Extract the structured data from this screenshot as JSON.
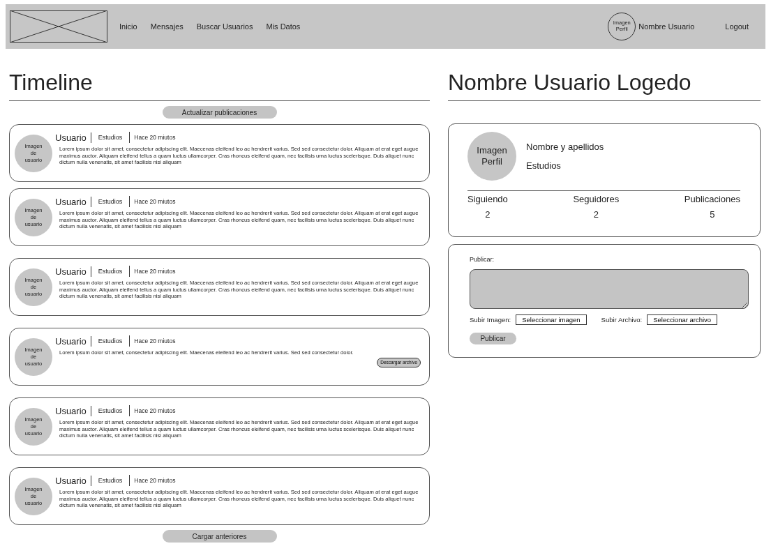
{
  "navbar": {
    "links": [
      {
        "label": "Inicio"
      },
      {
        "label": "Mensajes"
      },
      {
        "label": "Buscar Usuarios"
      },
      {
        "label": "Mis Datos"
      }
    ],
    "avatar": "Imagen\nPerfil",
    "user": "Nombre Usuario",
    "logout": "Logout"
  },
  "timeline": {
    "title": "Timeline",
    "refresh": "Actualizar publicaciones",
    "load_more": "Cargar anteriores",
    "posts": [
      {
        "avatar": "Imagen\nde\nusuario",
        "user": "Usuario",
        "studies": "Estudios",
        "time": "Hace 20 miutos",
        "body": "Lorem ipsum dolor sit amet, consectetur adipiscing elit. Maecenas eleifend leo ac hendrerit varius. Sed sed consectetur dolor. Aliquam at erat eget augue maximus auctor. Aliquam eleifend tellus a quam luctus ullamcorper. Cras rhoncus eleifend quam, nec facilisis urna luctus scelerisque. Duis aliquet nunc dictum nulla venenatis, sit amet facilisis nisi aliquam"
      },
      {
        "avatar": "Imagen\nde\nusuario",
        "user": "Usuario",
        "studies": "Estudios",
        "time": "Hace 20 miutos",
        "body": "Lorem ipsum dolor sit amet, consectetur adipiscing elit. Maecenas eleifend leo ac hendrerit varius. Sed sed consectetur dolor. Aliquam at erat eget augue maximus auctor. Aliquam eleifend tellus a quam luctus ullamcorper. Cras rhoncus eleifend quam, nec facilisis urna luctus scelerisque. Duis aliquet nunc dictum nulla venenatis, sit amet facilisis nisi aliquam"
      },
      {
        "avatar": "Imagen\nde\nusuario",
        "user": "Usuario",
        "studies": "Estudios",
        "time": "Hace 20 miutos",
        "body": "Lorem ipsum dolor sit amet, consectetur adipiscing elit. Maecenas eleifend leo ac hendrerit varius. Sed sed consectetur dolor. Aliquam at erat eget augue maximus auctor. Aliquam eleifend tellus a quam luctus ullamcorper. Cras rhoncus eleifend quam, nec facilisis urna luctus scelerisque. Duis aliquet nunc dictum nulla venenatis, sit amet facilisis nisi aliquam"
      },
      {
        "avatar": "Imagen\nde\nusuario",
        "user": "Usuario",
        "studies": "Estudios",
        "time": "Hace 20 miutos",
        "body": "Lorem ipsum dolor sit amet, consectetur adipiscing elit. Maecenas eleifend leo ac hendrerit varius. Sed sed consectetur dolor.",
        "attachment": "Descargar archivo"
      },
      {
        "avatar": "Imagen\nde\nusuario",
        "user": "Usuario",
        "studies": "Estudios",
        "time": "Hace 20 miutos",
        "body": "Lorem ipsum dolor sit amet, consectetur adipiscing elit. Maecenas eleifend leo ac hendrerit varius. Sed sed consectetur dolor. Aliquam at erat eget augue maximus auctor. Aliquam eleifend tellus a quam luctus ullamcorper. Cras rhoncus eleifend quam, nec facilisis urna luctus scelerisque. Duis aliquet nunc dictum nulla venenatis, sit amet facilisis nisi aliquam"
      },
      {
        "avatar": "Imagen\nde\nusuario",
        "user": "Usuario",
        "studies": "Estudios",
        "time": "Hace 20 miutos",
        "body": "Lorem ipsum dolor sit amet, consectetur adipiscing elit. Maecenas eleifend leo ac hendrerit varius. Sed sed consectetur dolor. Aliquam at erat eget augue maximus auctor. Aliquam eleifend tellus a quam luctus ullamcorper. Cras rhoncus eleifend quam, nec facilisis urna luctus scelerisque. Duis aliquet nunc dictum nulla venenatis, sit amet facilisis nisi aliquam"
      }
    ]
  },
  "profile": {
    "title": "Nombre Usuario Logedo",
    "avatar": "Imagen\nPerfil",
    "name": "Nombre y apellidos",
    "studies": "Estudios",
    "stats": [
      {
        "label": "Siguiendo",
        "value": "2"
      },
      {
        "label": "Seguidores",
        "value": "2"
      },
      {
        "label": "Publicaciones",
        "value": "5"
      }
    ]
  },
  "composer": {
    "label": "Publicar:",
    "image_label": "Subir Imagen:",
    "image_button": "Seleccionar imagen",
    "file_label": "Subir Archivo:",
    "file_button": "Seleccionar archivo",
    "submit": "Publicar"
  }
}
